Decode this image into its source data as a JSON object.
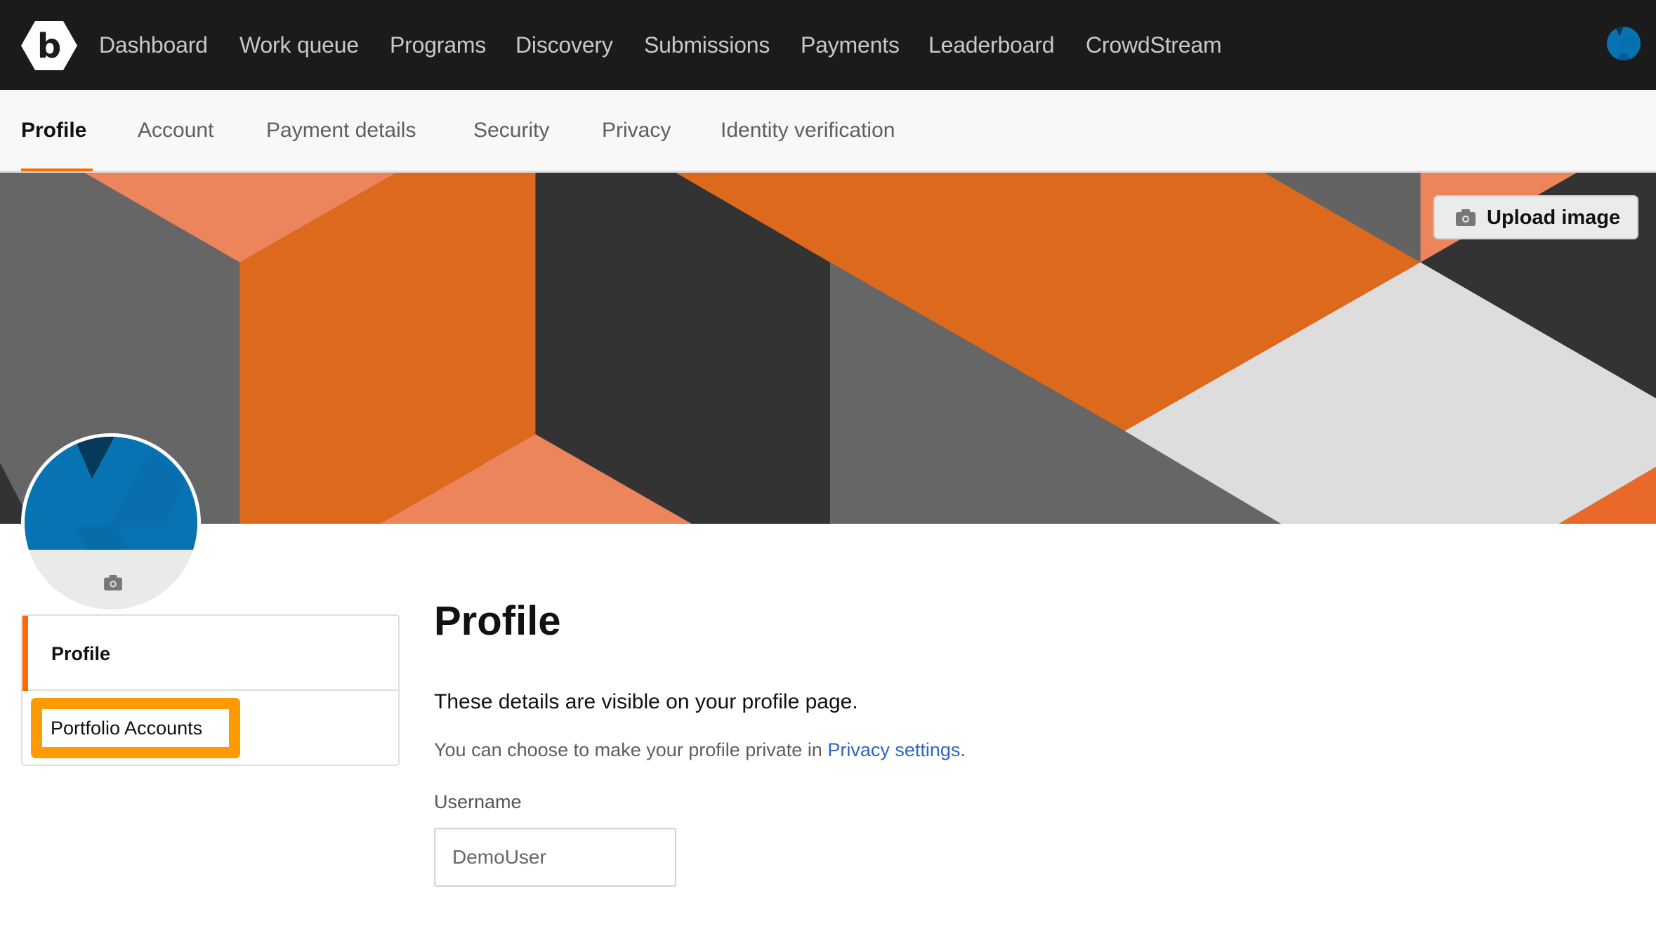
{
  "topnav": {
    "logo_icon": "bugcrowd-hexagon-b-logo",
    "logo_letter": "b",
    "items": [
      {
        "label": "Dashboard"
      },
      {
        "label": "Work queue"
      },
      {
        "label": "Programs"
      },
      {
        "label": "Discovery"
      },
      {
        "label": "Submissions"
      },
      {
        "label": "Payments"
      },
      {
        "label": "Leaderboard"
      },
      {
        "label": "CrowdStream"
      }
    ],
    "user_avatar_icon": "user-avatar"
  },
  "subnav": {
    "tabs": [
      {
        "label": "Profile",
        "active": true
      },
      {
        "label": "Account"
      },
      {
        "label": "Payment details"
      },
      {
        "label": "Security"
      },
      {
        "label": "Privacy"
      },
      {
        "label": "Identity verification"
      }
    ]
  },
  "banner": {
    "upload_label": "Upload image",
    "upload_icon": "camera-icon"
  },
  "avatar": {
    "camera_icon": "camera-icon"
  },
  "sidebar": {
    "items": [
      {
        "label": "Profile",
        "active": true
      },
      {
        "label": "Portfolio Accounts",
        "highlighted": true
      }
    ]
  },
  "main": {
    "title": "Profile",
    "description": "These details are visible on your profile page.",
    "note_prefix": "You can choose to make your profile private in ",
    "note_link": "Privacy settings",
    "note_suffix": ".",
    "username_label": "Username",
    "username_value": "DemoUser"
  },
  "colors": {
    "accent_orange": "#ff6a00",
    "highlight_orange": "#ff9b00",
    "link_blue": "#2f64c0",
    "topbar_bg": "#1b1b1b",
    "avatar_blue": "#0773b3"
  }
}
